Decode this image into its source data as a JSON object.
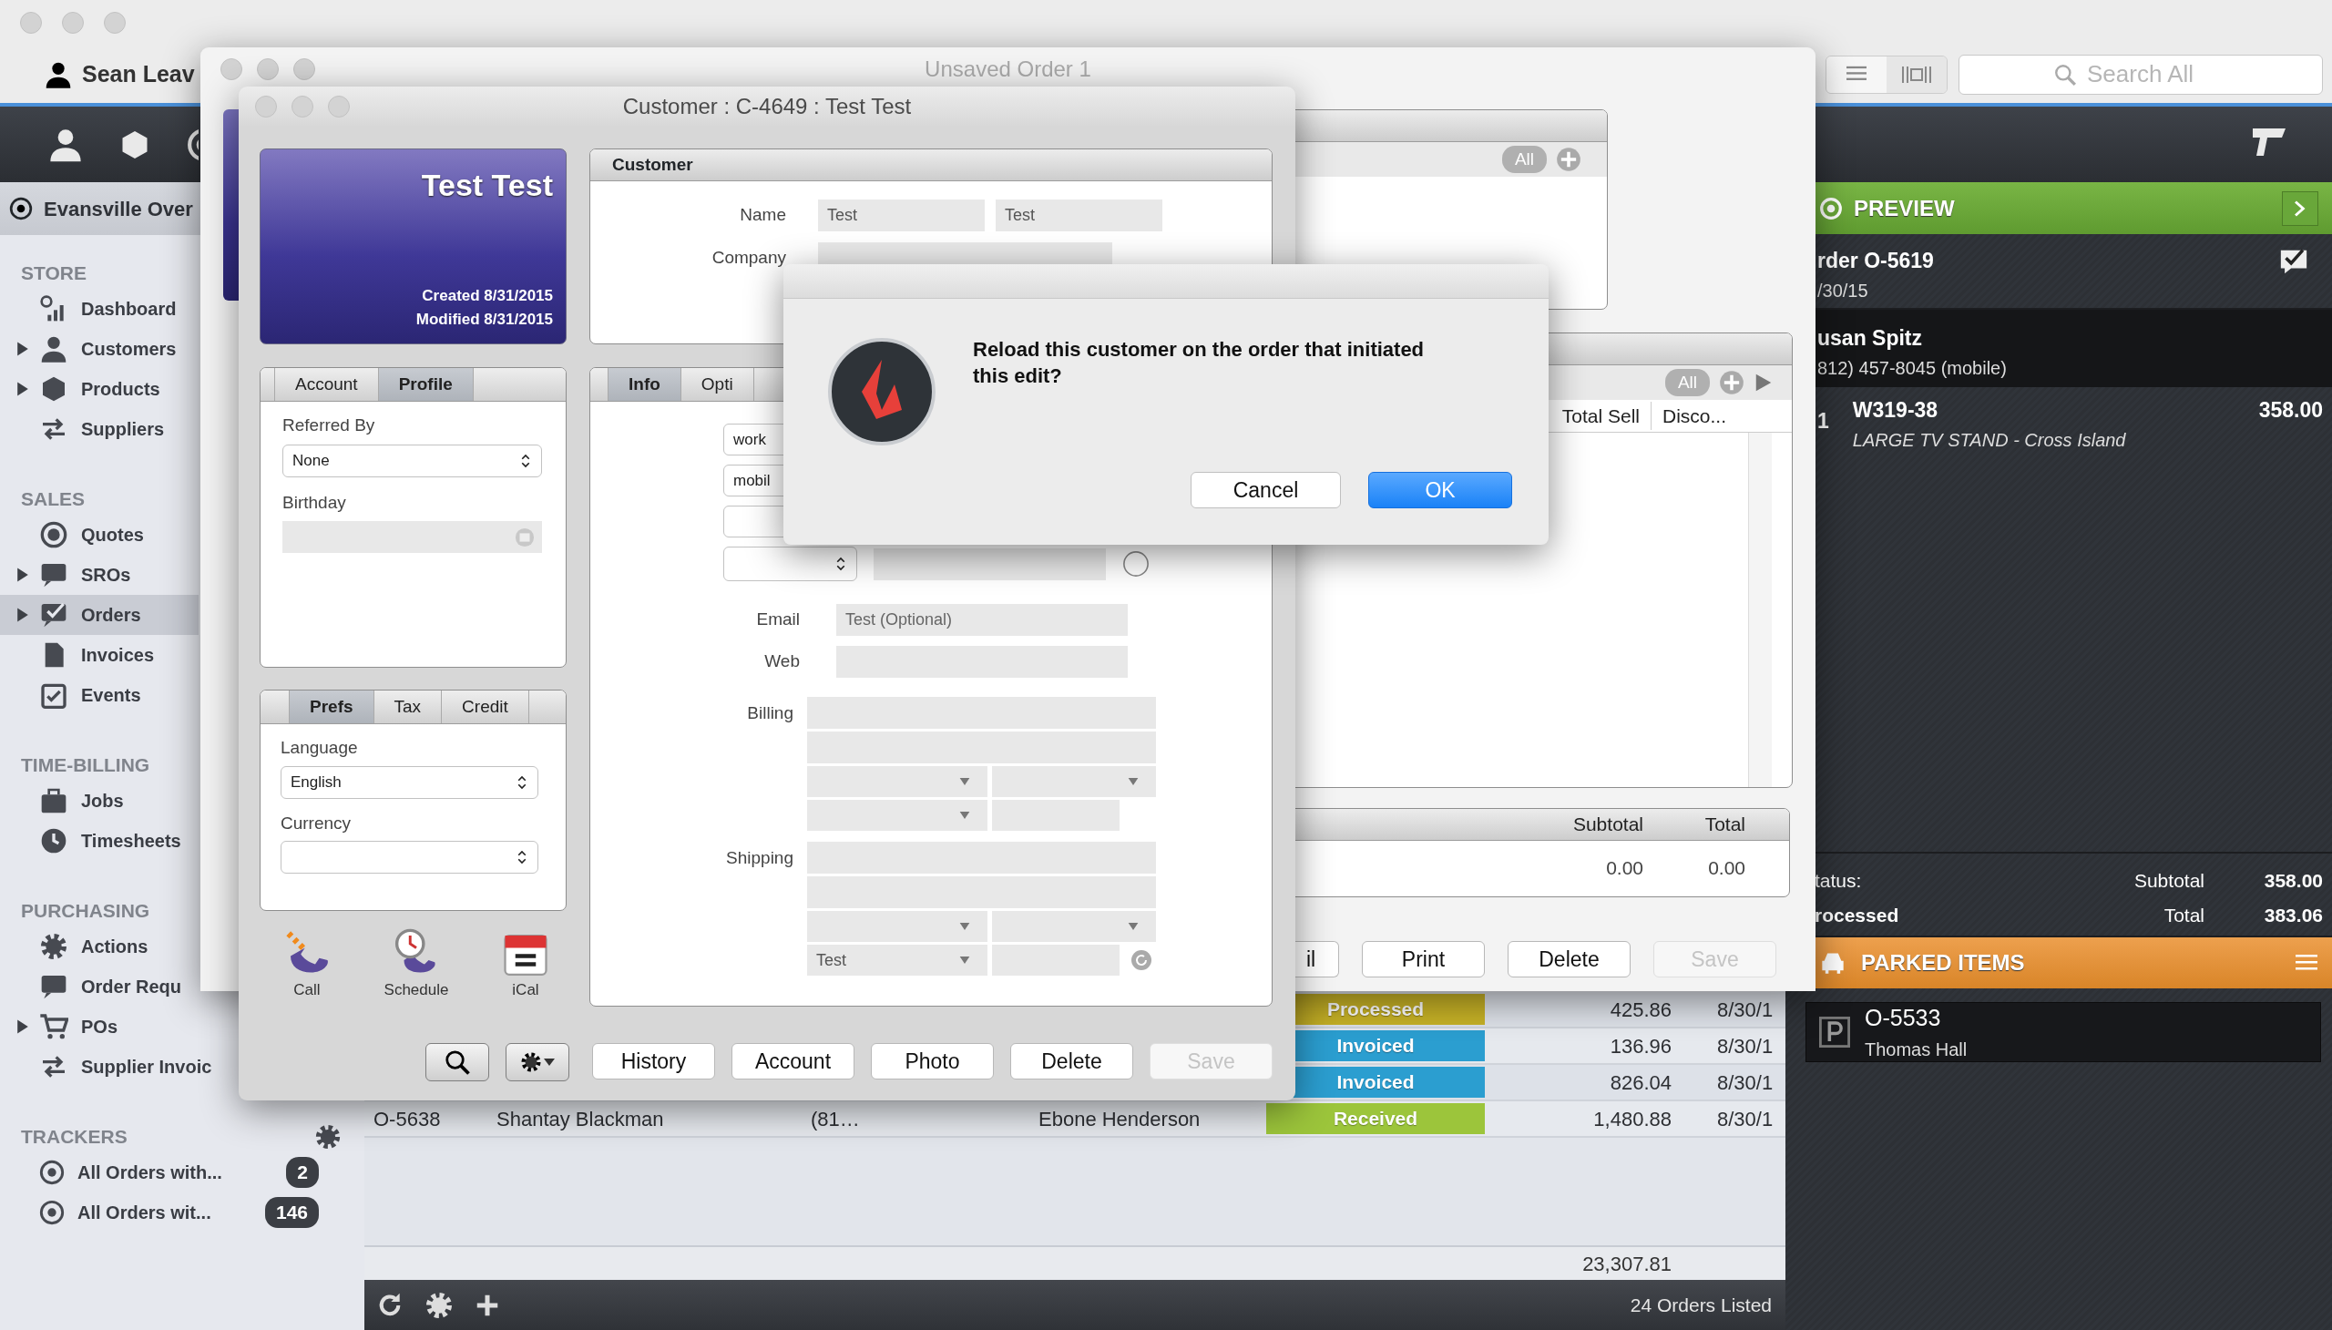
{
  "main_window": {
    "user": "Sean Leav",
    "search": {
      "placeholder": "Search All"
    },
    "location": "Evansville Over",
    "sidebar": [
      {
        "title": "STORE",
        "items": [
          {
            "label": "Dashboard",
            "expandable": false,
            "selected": false
          },
          {
            "label": "Customers",
            "expandable": true,
            "selected": false
          },
          {
            "label": "Products",
            "expandable": true,
            "selected": false
          },
          {
            "label": "Suppliers",
            "expandable": false,
            "selected": false
          }
        ]
      },
      {
        "title": "SALES",
        "items": [
          {
            "label": "Quotes",
            "expandable": false,
            "selected": false
          },
          {
            "label": "SROs",
            "expandable": true,
            "selected": false
          },
          {
            "label": "Orders",
            "expandable": true,
            "selected": true
          },
          {
            "label": "Invoices",
            "expandable": false,
            "selected": false
          },
          {
            "label": "Events",
            "expandable": false,
            "selected": false
          }
        ]
      },
      {
        "title": "TIME-BILLING",
        "items": [
          {
            "label": "Jobs",
            "expandable": false,
            "selected": false
          },
          {
            "label": "Timesheets",
            "expandable": false,
            "selected": false
          }
        ]
      },
      {
        "title": "PURCHASING",
        "items": [
          {
            "label": "Actions",
            "expandable": false,
            "selected": false
          },
          {
            "label": "Order Requ",
            "expandable": false,
            "selected": false
          },
          {
            "label": "POs",
            "expandable": true,
            "selected": false
          },
          {
            "label": "Supplier Invoic",
            "expandable": false,
            "selected": false
          }
        ]
      }
    ],
    "trackers": {
      "title": "TRACKERS",
      "items": [
        {
          "label": "All Orders with...",
          "count": "2"
        },
        {
          "label": "All Orders wit...",
          "count": "146"
        }
      ]
    },
    "orders": {
      "rows": [
        {
          "cells": [],
          "status": "Processed",
          "color": "#c6b126",
          "amount": "425.86",
          "date": "8/30/1"
        },
        {
          "cells": [],
          "status": "Invoiced",
          "color": "#2b9ed0",
          "amount": "136.96",
          "date": "8/30/1"
        },
        {
          "cells": [],
          "status": "Invoiced",
          "color": "#2b9ed0",
          "amount": "826.04",
          "date": "8/30/1"
        },
        {
          "cells": [
            "O-5638",
            "Shantay Blackman",
            "(81…",
            "Ebone Henderson"
          ],
          "status": "Received",
          "color": "#9cc53b",
          "amount": "1,480.88",
          "date": "8/30/1"
        }
      ],
      "grand_total": "23,307.81",
      "count_label": "24 Orders Listed"
    },
    "preview": {
      "title": "PREVIEW",
      "order": "rder O-5619",
      "date": "/30/15",
      "customer": "usan Spitz",
      "phone": "812) 457-8045 (mobile)",
      "lines": [
        {
          "qty": "1",
          "sku": "W319-38",
          "description": "LARGE TV STAND -  Cross Island",
          "price": "358.00"
        }
      ],
      "status_label": "tatus:",
      "status": "rocessed",
      "subtotal_label": "Subtotal",
      "subtotal": "358.00",
      "total_label": "Total",
      "total": "383.06"
    },
    "parked": {
      "title": "PARKED ITEMS",
      "items": [
        {
          "order": "O-5533",
          "customer": "Thomas Hall"
        }
      ]
    }
  },
  "order_window": {
    "title": "Unsaved Order 1",
    "filters": [
      "All",
      "All"
    ],
    "columns": [
      "Total Sell",
      "Disco..."
    ],
    "totals": {
      "labels": [
        "Subtotal",
        "Total"
      ],
      "values": [
        "0.00",
        "0.00"
      ]
    },
    "buttons": [
      {
        "label": "il",
        "disabled": false
      },
      {
        "label": "Print",
        "disabled": false
      },
      {
        "label": "Delete",
        "disabled": false
      },
      {
        "label": "Save",
        "disabled": true
      }
    ]
  },
  "customer_window": {
    "title": "Customer : C-4649 : Test Test",
    "card": {
      "name": "Test Test",
      "created": "Created 8/31/2015",
      "modified": "Modified 8/31/2015"
    },
    "profile_tabs": [
      {
        "label": "Account",
        "selected": false
      },
      {
        "label": "Profile",
        "selected": true
      }
    ],
    "referred_by": {
      "label": "Referred By",
      "value": "None"
    },
    "birthday_label": "Birthday",
    "prefs_tabs": [
      {
        "label": "Prefs",
        "selected": true
      },
      {
        "label": "Tax",
        "selected": false
      },
      {
        "label": "Credit",
        "selected": false
      }
    ],
    "language": {
      "label": "Language",
      "value": "English"
    },
    "currency_label": "Currency",
    "actions": [
      "Call",
      "Schedule",
      "iCal"
    ],
    "customer_panel": {
      "title": "Customer",
      "name_label": "Name",
      "first_name": "Test",
      "last_name": "Test",
      "company_label": "Company"
    },
    "info_tabs": [
      {
        "label": "Info",
        "selected": true
      },
      {
        "label": "Opti",
        "selected": false
      }
    ],
    "phone_types": [
      "work",
      "mobil"
    ],
    "email": {
      "label": "Email",
      "placeholder": "Test (Optional)"
    },
    "web_label": "Web",
    "billing_label": "Billing",
    "shipping_label": "Shipping",
    "shipping_country": "Test",
    "buttons": [
      {
        "label": "History",
        "disabled": false
      },
      {
        "label": "Account",
        "disabled": false
      },
      {
        "label": "Photo",
        "disabled": false
      },
      {
        "label": "Delete",
        "disabled": false
      },
      {
        "label": "Save",
        "disabled": true
      }
    ]
  },
  "dialog": {
    "message": "Reload this customer on the order that initiated this edit?",
    "buttons": [
      {
        "label": "Cancel",
        "default": false
      },
      {
        "label": "OK",
        "default": true
      }
    ]
  }
}
